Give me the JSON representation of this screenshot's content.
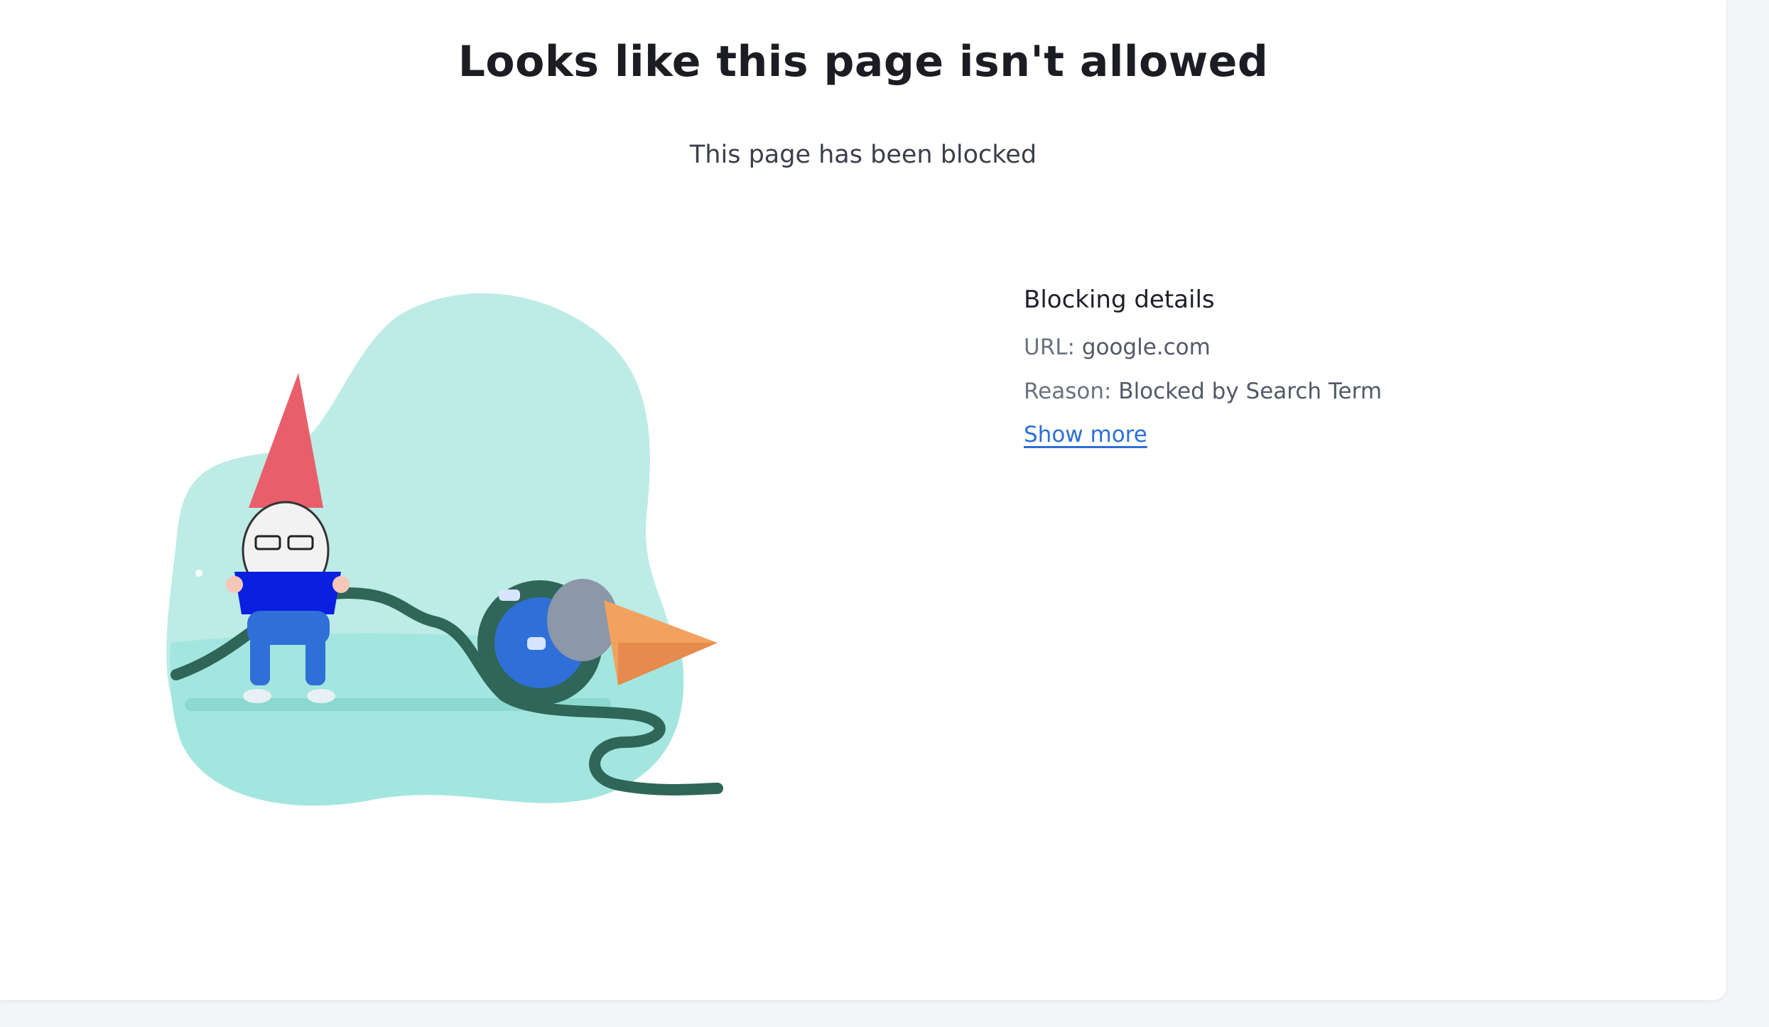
{
  "header": {
    "title": "Looks like this page isn't allowed",
    "subtitle": "This page has been blocked"
  },
  "details": {
    "heading": "Blocking details",
    "url_label": "URL:",
    "url_value": "google.com",
    "reason_label": "Reason:",
    "reason_value": "Blocked by Search Term",
    "show_more": "Show more"
  },
  "illustration": {
    "blob_color": "#bdebe5",
    "ground_color": "#a2e6df",
    "hose_color": "#2f6657",
    "hat_color": "#e85f6b",
    "reel_color": "#2f6fd8",
    "nozzle_color": "#f0a25e"
  }
}
